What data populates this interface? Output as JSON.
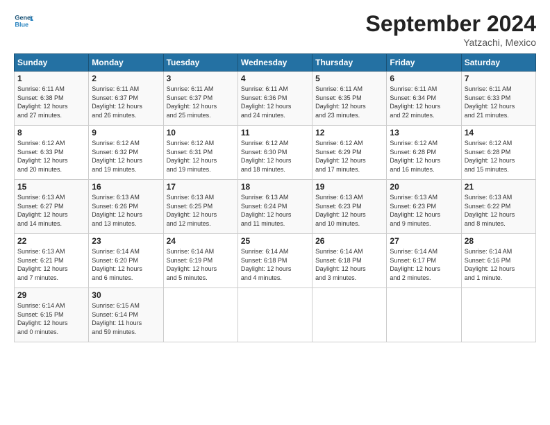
{
  "logo": {
    "line1": "General",
    "line2": "Blue"
  },
  "title": "September 2024",
  "subtitle": "Yatzachi, Mexico",
  "header": {
    "days": [
      "Sunday",
      "Monday",
      "Tuesday",
      "Wednesday",
      "Thursday",
      "Friday",
      "Saturday"
    ]
  },
  "weeks": [
    [
      {
        "day": "1",
        "info": "Sunrise: 6:11 AM\nSunset: 6:38 PM\nDaylight: 12 hours\nand 27 minutes."
      },
      {
        "day": "2",
        "info": "Sunrise: 6:11 AM\nSunset: 6:37 PM\nDaylight: 12 hours\nand 26 minutes."
      },
      {
        "day": "3",
        "info": "Sunrise: 6:11 AM\nSunset: 6:37 PM\nDaylight: 12 hours\nand 25 minutes."
      },
      {
        "day": "4",
        "info": "Sunrise: 6:11 AM\nSunset: 6:36 PM\nDaylight: 12 hours\nand 24 minutes."
      },
      {
        "day": "5",
        "info": "Sunrise: 6:11 AM\nSunset: 6:35 PM\nDaylight: 12 hours\nand 23 minutes."
      },
      {
        "day": "6",
        "info": "Sunrise: 6:11 AM\nSunset: 6:34 PM\nDaylight: 12 hours\nand 22 minutes."
      },
      {
        "day": "7",
        "info": "Sunrise: 6:11 AM\nSunset: 6:33 PM\nDaylight: 12 hours\nand 21 minutes."
      }
    ],
    [
      {
        "day": "8",
        "info": "Sunrise: 6:12 AM\nSunset: 6:33 PM\nDaylight: 12 hours\nand 20 minutes."
      },
      {
        "day": "9",
        "info": "Sunrise: 6:12 AM\nSunset: 6:32 PM\nDaylight: 12 hours\nand 19 minutes."
      },
      {
        "day": "10",
        "info": "Sunrise: 6:12 AM\nSunset: 6:31 PM\nDaylight: 12 hours\nand 19 minutes."
      },
      {
        "day": "11",
        "info": "Sunrise: 6:12 AM\nSunset: 6:30 PM\nDaylight: 12 hours\nand 18 minutes."
      },
      {
        "day": "12",
        "info": "Sunrise: 6:12 AM\nSunset: 6:29 PM\nDaylight: 12 hours\nand 17 minutes."
      },
      {
        "day": "13",
        "info": "Sunrise: 6:12 AM\nSunset: 6:28 PM\nDaylight: 12 hours\nand 16 minutes."
      },
      {
        "day": "14",
        "info": "Sunrise: 6:12 AM\nSunset: 6:28 PM\nDaylight: 12 hours\nand 15 minutes."
      }
    ],
    [
      {
        "day": "15",
        "info": "Sunrise: 6:13 AM\nSunset: 6:27 PM\nDaylight: 12 hours\nand 14 minutes."
      },
      {
        "day": "16",
        "info": "Sunrise: 6:13 AM\nSunset: 6:26 PM\nDaylight: 12 hours\nand 13 minutes."
      },
      {
        "day": "17",
        "info": "Sunrise: 6:13 AM\nSunset: 6:25 PM\nDaylight: 12 hours\nand 12 minutes."
      },
      {
        "day": "18",
        "info": "Sunrise: 6:13 AM\nSunset: 6:24 PM\nDaylight: 12 hours\nand 11 minutes."
      },
      {
        "day": "19",
        "info": "Sunrise: 6:13 AM\nSunset: 6:23 PM\nDaylight: 12 hours\nand 10 minutes."
      },
      {
        "day": "20",
        "info": "Sunrise: 6:13 AM\nSunset: 6:23 PM\nDaylight: 12 hours\nand 9 minutes."
      },
      {
        "day": "21",
        "info": "Sunrise: 6:13 AM\nSunset: 6:22 PM\nDaylight: 12 hours\nand 8 minutes."
      }
    ],
    [
      {
        "day": "22",
        "info": "Sunrise: 6:13 AM\nSunset: 6:21 PM\nDaylight: 12 hours\nand 7 minutes."
      },
      {
        "day": "23",
        "info": "Sunrise: 6:14 AM\nSunset: 6:20 PM\nDaylight: 12 hours\nand 6 minutes."
      },
      {
        "day": "24",
        "info": "Sunrise: 6:14 AM\nSunset: 6:19 PM\nDaylight: 12 hours\nand 5 minutes."
      },
      {
        "day": "25",
        "info": "Sunrise: 6:14 AM\nSunset: 6:18 PM\nDaylight: 12 hours\nand 4 minutes."
      },
      {
        "day": "26",
        "info": "Sunrise: 6:14 AM\nSunset: 6:18 PM\nDaylight: 12 hours\nand 3 minutes."
      },
      {
        "day": "27",
        "info": "Sunrise: 6:14 AM\nSunset: 6:17 PM\nDaylight: 12 hours\nand 2 minutes."
      },
      {
        "day": "28",
        "info": "Sunrise: 6:14 AM\nSunset: 6:16 PM\nDaylight: 12 hours\nand 1 minute."
      }
    ],
    [
      {
        "day": "29",
        "info": "Sunrise: 6:14 AM\nSunset: 6:15 PM\nDaylight: 12 hours\nand 0 minutes."
      },
      {
        "day": "30",
        "info": "Sunrise: 6:15 AM\nSunset: 6:14 PM\nDaylight: 11 hours\nand 59 minutes."
      },
      {
        "day": "",
        "info": ""
      },
      {
        "day": "",
        "info": ""
      },
      {
        "day": "",
        "info": ""
      },
      {
        "day": "",
        "info": ""
      },
      {
        "day": "",
        "info": ""
      }
    ]
  ]
}
